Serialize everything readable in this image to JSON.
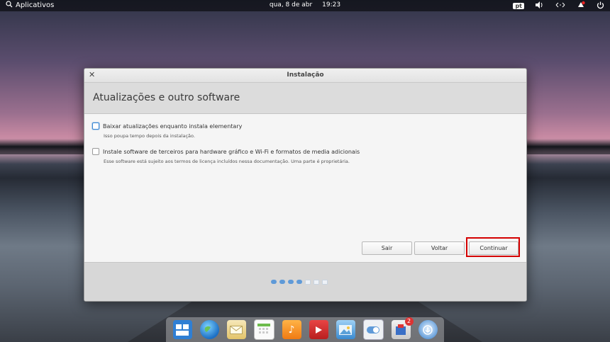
{
  "topbar": {
    "apps_label": "Aplicativos",
    "date": "qua, 8 de abr",
    "time": "19:23",
    "keyboard_layout": "pt"
  },
  "window": {
    "title": "Instalação",
    "heading": "Atualizações e outro software",
    "options": [
      {
        "label": "Baixar atualizações enquanto instala elementary",
        "description": "Isso poupa tempo depois da instalação.",
        "checked": false
      },
      {
        "label": "Instale software de terceiros para hardware gráfico e Wi-Fi e formatos de media adicionais",
        "description": "Esse software está sujeito aos termos de licença incluídos nessa documentação. Uma parte é proprietária.",
        "checked": false
      }
    ],
    "buttons": {
      "quit": "Sair",
      "back": "Voltar",
      "continue": "Continuar"
    },
    "progress": {
      "total_steps": 7,
      "completed_steps": 4
    }
  },
  "dock": {
    "notification_count": "2"
  },
  "colors": {
    "accent": "#5f9ad8",
    "highlight": "#d40000"
  }
}
